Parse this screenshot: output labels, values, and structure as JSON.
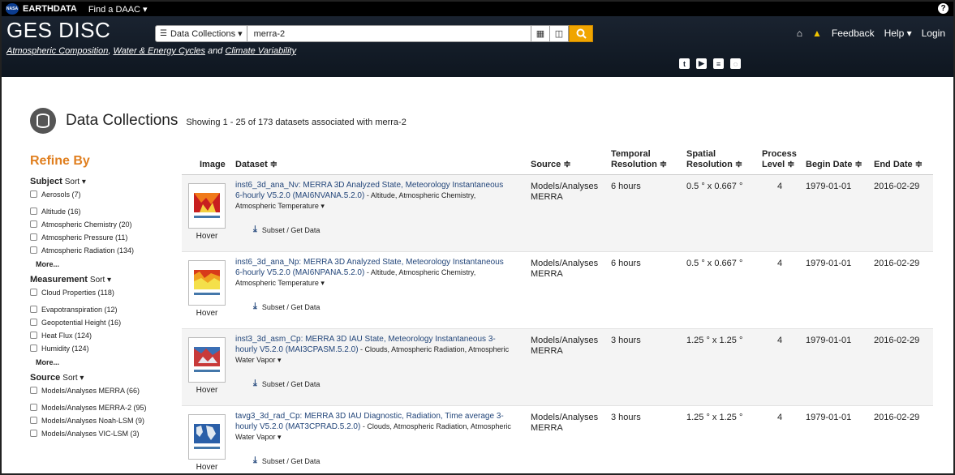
{
  "topbar": {
    "nasa_label": "NASA",
    "earthdata": "EARTHDATA",
    "find_daac": "Find a DAAC ▾",
    "help_icon": "?"
  },
  "header": {
    "brand": "GES DISC",
    "subtitle_parts": [
      "Atmospheric Composition",
      ", ",
      "Water & Energy Cycles",
      " and ",
      "Climate Variability"
    ],
    "collection_dropdown": "Data Collections ▾",
    "search_value": "merra-2",
    "nav": {
      "feedback": "Feedback",
      "help": "Help ▾",
      "login": "Login"
    }
  },
  "page": {
    "title": "Data Collections",
    "showing": "Showing 1 - 25 of 173 datasets associated with merra-2"
  },
  "sidebar": {
    "refine": "Refine By",
    "facets": [
      {
        "name": "Subject",
        "sort": "Sort ▾",
        "items": [
          "Aerosols (7)",
          "Altitude (16)",
          "Atmospheric Chemistry (20)",
          "Atmospheric Pressure (11)",
          "Atmospheric Radiation (134)"
        ],
        "more": "More..."
      },
      {
        "name": "Measurement",
        "sort": "Sort ▾",
        "items": [
          "Cloud Properties (118)",
          "Evapotranspiration (12)",
          "Geopotential Height (16)",
          "Heat Flux (124)",
          "Humidity (124)"
        ],
        "more": "More..."
      },
      {
        "name": "Source",
        "sort": "Sort ▾",
        "items": [
          "Models/Analyses MERRA (66)",
          "Models/Analyses MERRA-2 (95)",
          "Models/Analyses Noah-LSM (9)",
          "Models/Analyses VIC-LSM (3)"
        ]
      }
    ]
  },
  "table": {
    "headers": {
      "image": "Image",
      "dataset": "Dataset ≑",
      "source": "Source ≑",
      "temporal_1": "Temporal",
      "temporal_2": "Resolution ≑",
      "spatial_1": "Spatial",
      "spatial_2": "Resolution ≑",
      "process_1": "Process",
      "process_2": "Level ≑",
      "begin": "Begin Date ≑",
      "end": "End Date ≑"
    },
    "hover_label": "Hover",
    "subset_label": "Subset / Get Data",
    "rows": [
      {
        "title": "inst6_3d_ana_Nv: MERRA 3D Analyzed State, Meteorology Instantaneous 6-hourly V5.2.0 (MAI6NVANA.5.2.0)",
        "tags": " - Altitude, Atmospheric Chemistry, Atmospheric Temperature ▾",
        "source": "Models/Analyses MERRA",
        "temporal": "6 hours",
        "spatial": "0.5 ° x 0.667 °",
        "level": "4",
        "begin": "1979-01-01",
        "end": "2016-02-29"
      },
      {
        "title": "inst6_3d_ana_Np: MERRA 3D Analyzed State, Meteorology Instantaneous 6-hourly V5.2.0 (MAI6NPANA.5.2.0)",
        "tags": " - Altitude, Atmospheric Chemistry, Atmospheric Temperature ▾",
        "source": "Models/Analyses MERRA",
        "temporal": "6 hours",
        "spatial": "0.5 ° x 0.667 °",
        "level": "4",
        "begin": "1979-01-01",
        "end": "2016-02-29"
      },
      {
        "title": "inst3_3d_asm_Cp: MERRA 3D IAU State, Meteorology Instantaneous 3-hourly V5.2.0 (MAI3CPASM.5.2.0)",
        "tags": " - Clouds, Atmospheric Radiation, Atmospheric Water Vapor ▾",
        "source": "Models/Analyses MERRA",
        "temporal": "3 hours",
        "spatial": "1.25 ° x 1.25 °",
        "level": "4",
        "begin": "1979-01-01",
        "end": "2016-02-29"
      },
      {
        "title": "tavg3_3d_rad_Cp: MERRA 3D IAU Diagnostic, Radiation, Time average 3-hourly V5.2.0 (MAT3CPRAD.5.2.0)",
        "tags": " - Clouds, Atmospheric Radiation, Atmospheric Water Vapor ▾",
        "source": "Models/Analyses MERRA",
        "temporal": "3 hours",
        "spatial": "1.25 ° x 1.25 °",
        "level": "4",
        "begin": "1979-01-01",
        "end": "2016-02-29"
      }
    ]
  }
}
